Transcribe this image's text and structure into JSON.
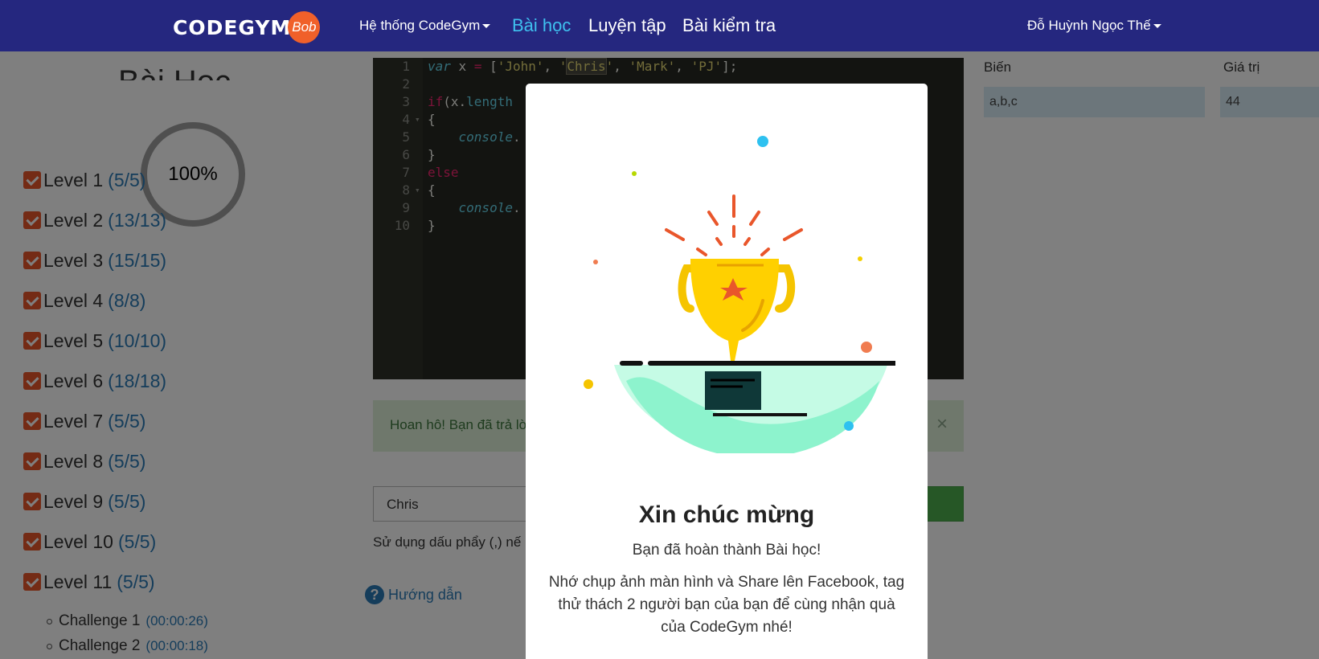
{
  "navbar": {
    "logo_text": "CODEGYM",
    "logo_badge": "Bob",
    "system_menu": "Hệ thống CodeGym",
    "lessons": "Bài học",
    "practice": "Luyện tập",
    "test": "Bài kiểm tra",
    "user": "Đỗ Huỳnh Ngọc Thế"
  },
  "sidebar": {
    "title": "Bài Học",
    "progress": "100%",
    "levels": [
      {
        "label": "Level 1",
        "count": "(5/5)"
      },
      {
        "label": "Level 2",
        "count": "(13/13)"
      },
      {
        "label": "Level 3",
        "count": "(15/15)"
      },
      {
        "label": "Level 4",
        "count": "(8/8)"
      },
      {
        "label": "Level 5",
        "count": "(10/10)"
      },
      {
        "label": "Level 6",
        "count": "(18/18)"
      },
      {
        "label": "Level 7",
        "count": "(5/5)"
      },
      {
        "label": "Level 8",
        "count": "(5/5)"
      },
      {
        "label": "Level 9",
        "count": "(5/5)"
      },
      {
        "label": "Level 10",
        "count": "(5/5)"
      },
      {
        "label": "Level 11",
        "count": "(5/5)"
      }
    ],
    "challenges": [
      {
        "label": "Challenge 1",
        "time": "(00:00:26)"
      },
      {
        "label": "Challenge 2",
        "time": "(00:00:18)"
      }
    ]
  },
  "editor": {
    "line_numbers": [
      "1",
      "2",
      "3",
      "4",
      "5",
      "6",
      "7",
      "8",
      "9",
      "10"
    ],
    "line1": {
      "var": "var",
      "rest1": " x ",
      "eq": "=",
      "rest2": " [",
      "s1": "'John'",
      "c1": ", ",
      "s2a": "'",
      "s2b": "Chris",
      "s2c": "'",
      "c2": ", ",
      "s3": "'Mark'",
      "c3": ", ",
      "s4": "'PJ'",
      "end": "];"
    },
    "line3": {
      "if": "if",
      "open": "(x.",
      "prop": "length"
    },
    "line4": "{",
    "line5": {
      "indent": "    ",
      "console": "console",
      "dot": "."
    },
    "line6": "}",
    "line7": "else",
    "line8": "{",
    "line9": {
      "indent": "    ",
      "console": "console",
      "dot": "."
    },
    "line10": "}"
  },
  "alert": {
    "text": "Hoan hô! Bạn đã trả lờ",
    "close": "×"
  },
  "answer": {
    "value": "Chris"
  },
  "hint": "Sử dụng dấu phẩy (,) nế",
  "guide": {
    "icon": "?",
    "label": "Hướng dẫn"
  },
  "variables": {
    "name_header": "Biến",
    "value_header": "Giá trị",
    "name": "a,b,c",
    "value": "44"
  },
  "modal": {
    "title": "Xin chúc mừng",
    "subtitle": "Bạn đã hoàn thành Bài học!",
    "body": "Nhớ chụp ảnh màn hình và Share lên Facebook, tag thử thách 2 người bạn của bạn để cùng nhận quà của CodeGym nhé!",
    "illustration": "trophy-icon"
  },
  "colors": {
    "navbar": "#25277f",
    "nav_active": "#3fc1ef",
    "check": "#e9562b",
    "link": "#2a7ab7",
    "success": "#4cae4c"
  }
}
